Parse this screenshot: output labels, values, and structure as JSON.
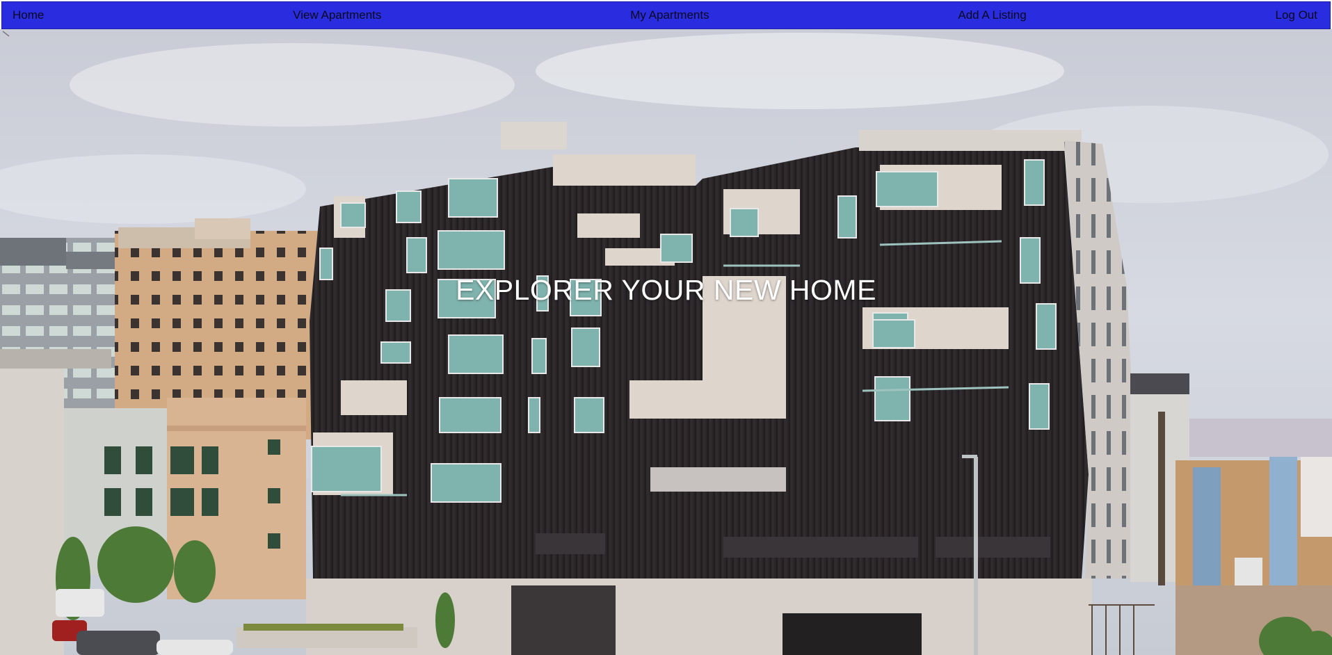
{
  "nav": {
    "home": "Home",
    "view_apartments": "View Apartments",
    "my_apartments": "My Apartments",
    "add_listing": "Add A Listing",
    "logout": "Log Out"
  },
  "hero": {
    "title": "EXPLORER YOUR NEW HOME",
    "image_icon": "broken-image-icon"
  },
  "colors": {
    "nav_background": "#2a2ce0",
    "nav_text": "#0a0a1e",
    "hero_title": "#ffffff"
  }
}
